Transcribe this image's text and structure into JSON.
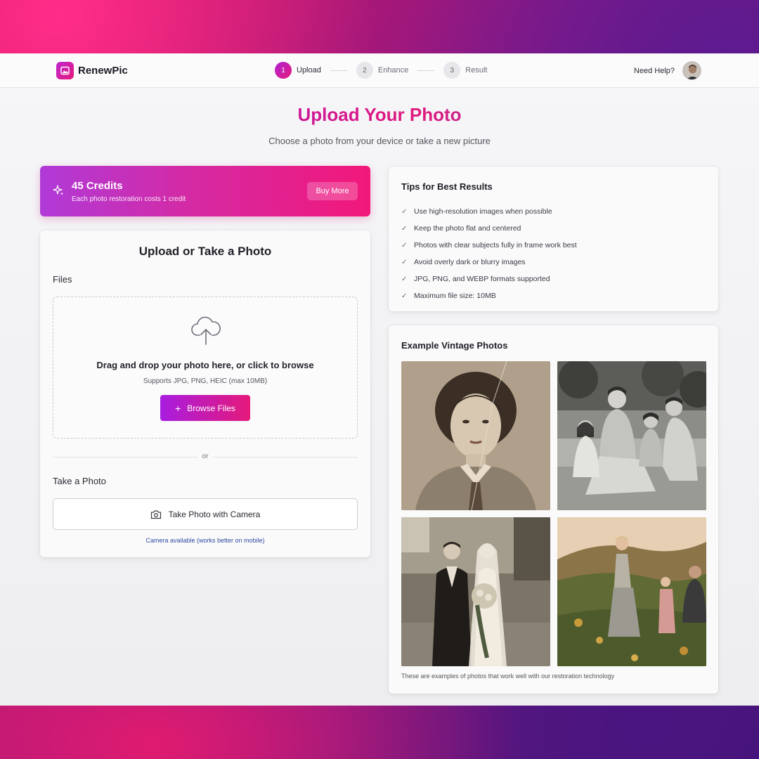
{
  "brand": {
    "name": "RenewPic"
  },
  "steps": [
    {
      "number": "1",
      "label": "Upload",
      "active": true
    },
    {
      "number": "2",
      "label": "Enhance",
      "active": false
    },
    {
      "number": "3",
      "label": "Result",
      "active": false
    }
  ],
  "header": {
    "help_label": "Need Help?"
  },
  "page": {
    "title": "Upload Your Photo",
    "subtitle": "Choose a photo from your device or take a new picture"
  },
  "credits": {
    "title": "45 Credits",
    "subtitle": "Each photo restoration costs 1 credit",
    "buy_label": "Buy More"
  },
  "upload": {
    "title": "Upload or Take a Photo",
    "files_label": "Files",
    "drop_title": "Drag and drop your photo here, or click to browse",
    "drop_sub": "Supports JPG, PNG, HEIC (max 10MB)",
    "browse_label": "Browse Files",
    "divider_label": "or",
    "take_label": "Take a Photo",
    "camera_button": "Take Photo with Camera",
    "camera_note": "Camera available (works better on mobile)"
  },
  "tips": {
    "title": "Tips for Best Results",
    "items": [
      "Use high-resolution images when possible",
      "Keep the photo flat and centered",
      "Photos with clear subjects fully in frame work best",
      "Avoid overly dark or blurry images",
      "JPG, PNG, and WEBP formats supported",
      "Maximum file size: 10MB"
    ]
  },
  "examples": {
    "title": "Example Vintage Photos",
    "caption": "These are examples of photos that work well with our restoration technology"
  },
  "colors": {
    "accent_purple": "#a81de0",
    "accent_pink": "#e5197a",
    "link_blue": "#2f4aa0"
  },
  "icons": [
    "image-icon",
    "sparkles-icon",
    "cloud-upload-icon",
    "plus-icon",
    "camera-icon",
    "check-icon"
  ]
}
